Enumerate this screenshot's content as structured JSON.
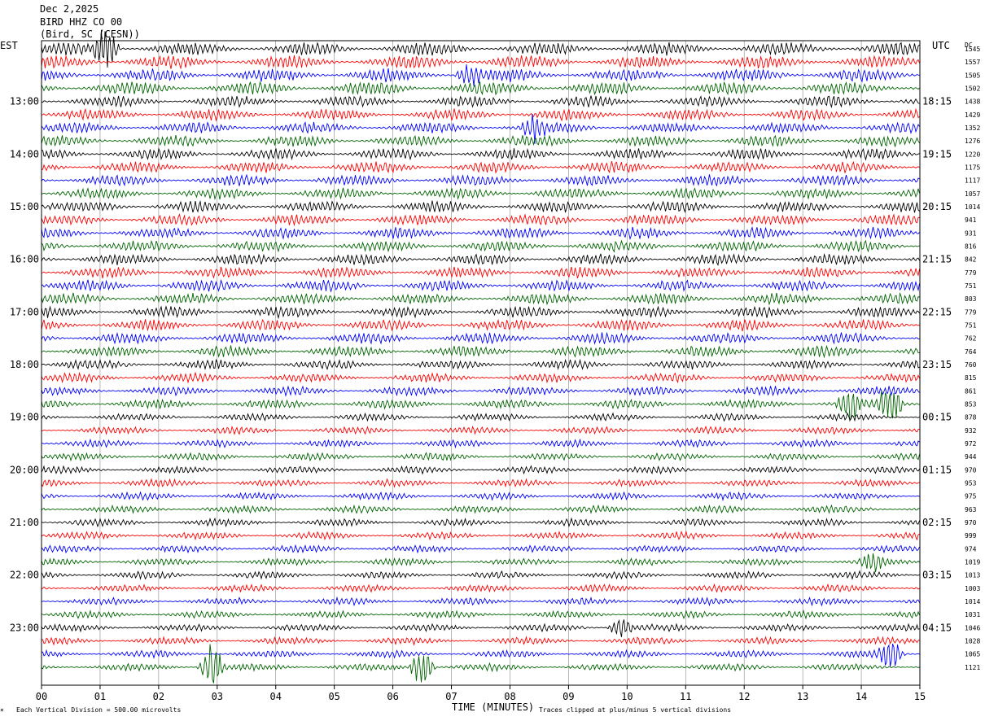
{
  "header": {
    "date": "Dec 2,2025",
    "station": "BIRD HHZ CO 00",
    "location": "(Bird, SC (CESN))"
  },
  "left_zone_label": "EST",
  "right_zone_label": "UTC",
  "dc_header": "DC",
  "footer": {
    "scale_note": "Each Vertical Division =  500.00 microvolts",
    "x_title": "TIME (MINUTES)",
    "clip_note": "Traces clipped at plus/minus 5 vertical divisions"
  },
  "colors": {
    "trace_cycle": [
      "#000000",
      "#ff0000",
      "#0000ff",
      "#006400"
    ],
    "grid": "#888888",
    "frame": "#000000"
  },
  "chart_data": {
    "type": "line",
    "subtype": "helicorder",
    "x_ticks": [
      "00",
      "01",
      "02",
      "03",
      "04",
      "05",
      "06",
      "07",
      "08",
      "09",
      "10",
      "11",
      "12",
      "13",
      "14",
      "15"
    ],
    "xlim": [
      0,
      15
    ],
    "xlabel": "TIME (MINUTES)",
    "rows_per_hour": 4,
    "start_hour_est": 12,
    "left_hour_labels": [
      "13:00",
      "14:00",
      "15:00",
      "16:00",
      "17:00",
      "18:00",
      "19:00",
      "20:00",
      "21:00",
      "22:00",
      "23:00"
    ],
    "right_hour_labels": [
      "18:15",
      "19:15",
      "20:15",
      "21:15",
      "22:15",
      "23:15",
      "00:15",
      "01:15",
      "02:15",
      "03:15",
      "04:15"
    ],
    "dc_offsets": [
      1545,
      1557,
      1505,
      1502,
      1438,
      1429,
      1352,
      1276,
      1220,
      1175,
      1117,
      1057,
      1014,
      941,
      931,
      816,
      842,
      779,
      751,
      803,
      779,
      751,
      762,
      764,
      760,
      815,
      861,
      853,
      878,
      932,
      972,
      944,
      970,
      953,
      975,
      963,
      970,
      999,
      974,
      1019,
      1013,
      1003,
      1014,
      1031,
      1046,
      1028,
      1065,
      1121
    ],
    "trace_amplitude_divisions": [
      3.5,
      3.5,
      3.5,
      3.5,
      3,
      3,
      3,
      3,
      3,
      3,
      3,
      3,
      3,
      3,
      3,
      3,
      3,
      3,
      3,
      3,
      3,
      3,
      3,
      3,
      2.5,
      2.5,
      2.5,
      2.5,
      2,
      2,
      2,
      2,
      2,
      2,
      2,
      2,
      2,
      2,
      2,
      2,
      2,
      2,
      2,
      2,
      2,
      2,
      2,
      2
    ],
    "events": [
      {
        "row": 0,
        "minute": 1.1,
        "divisions": 5
      },
      {
        "row": 2,
        "minute": 7.3,
        "divisions": 2
      },
      {
        "row": 6,
        "minute": 8.4,
        "divisions": 2
      },
      {
        "row": 27,
        "minute": 13.8,
        "divisions": 3
      },
      {
        "row": 27,
        "minute": 14.5,
        "divisions": 4
      },
      {
        "row": 39,
        "minute": 14.2,
        "divisions": 1.5
      },
      {
        "row": 44,
        "minute": 9.9,
        "divisions": 2
      },
      {
        "row": 46,
        "minute": 14.5,
        "divisions": 3
      },
      {
        "row": 47,
        "minute": 2.9,
        "divisions": 5
      },
      {
        "row": 47,
        "minute": 6.5,
        "divisions": 4
      }
    ]
  }
}
